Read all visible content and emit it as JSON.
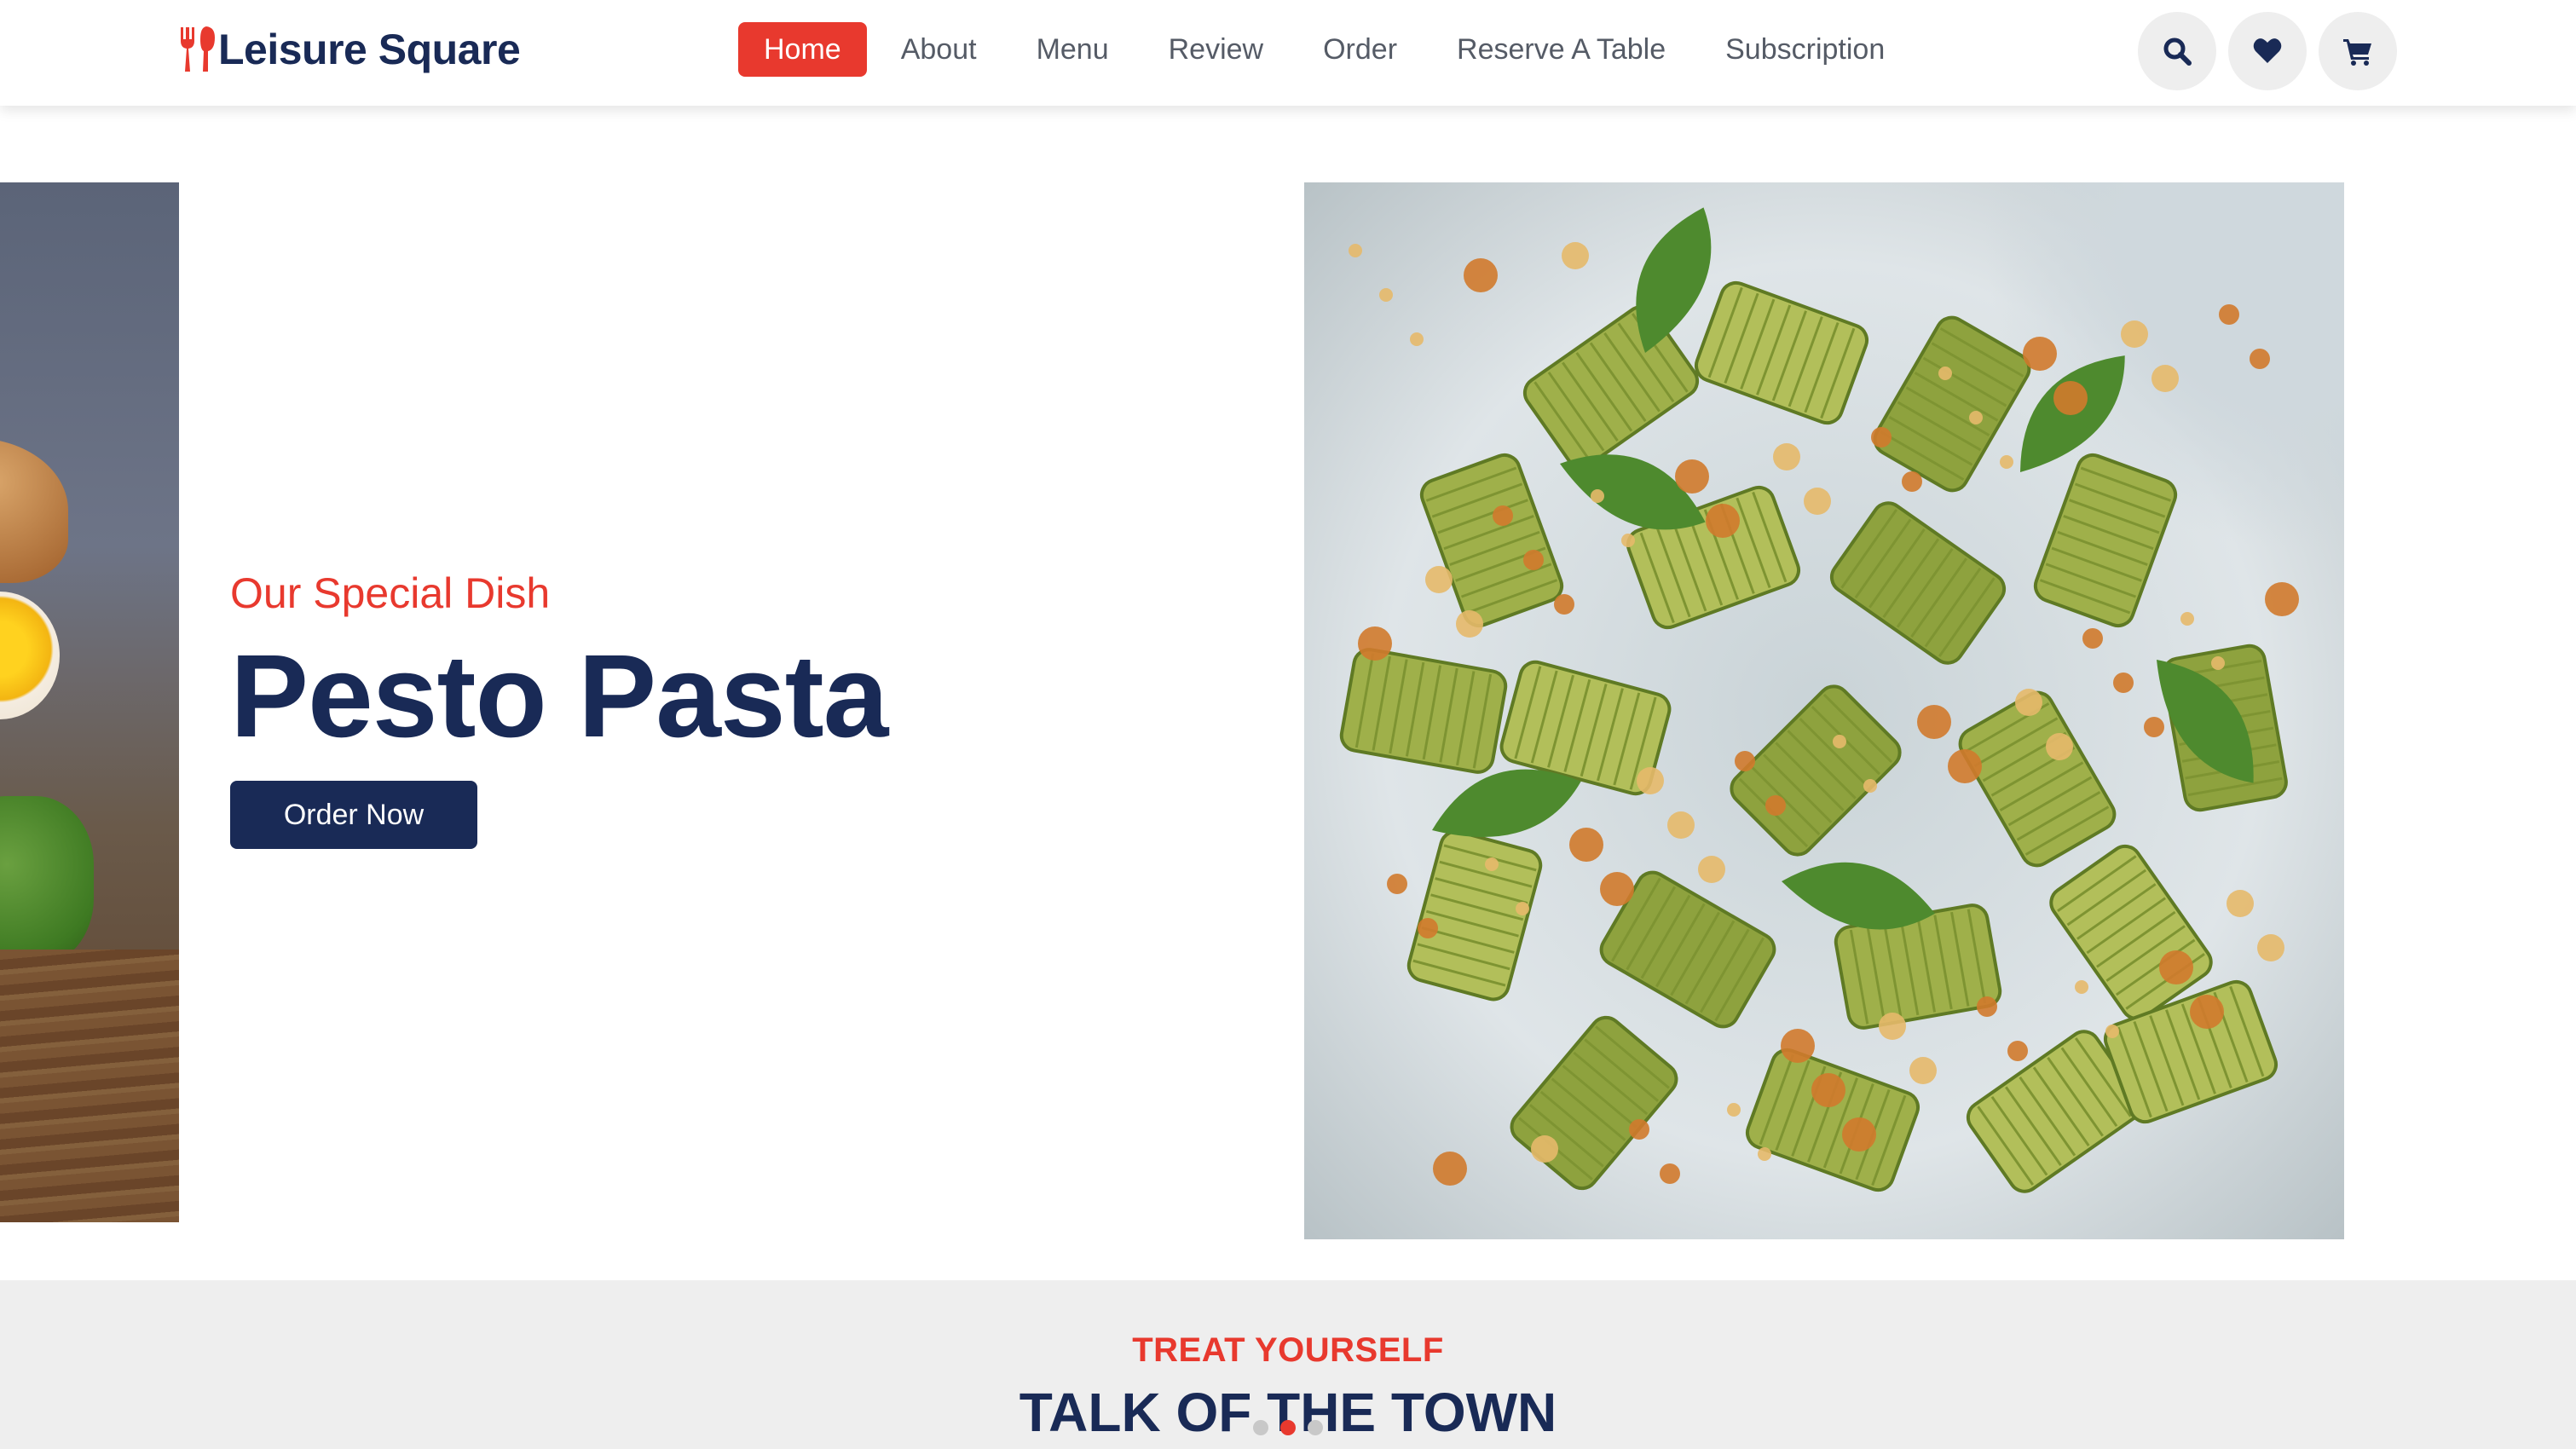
{
  "brand": {
    "name": "Leisure Square",
    "logo_icon": "utensils-icon",
    "accent_color": "#e8392e",
    "primary_color": "#192a56"
  },
  "nav": {
    "items": [
      {
        "label": "Home",
        "active": true
      },
      {
        "label": "About",
        "active": false
      },
      {
        "label": "Menu",
        "active": false
      },
      {
        "label": "Review",
        "active": false
      },
      {
        "label": "Order",
        "active": false
      },
      {
        "label": "Reserve A Table",
        "active": false
      },
      {
        "label": "Subscription",
        "active": false
      }
    ]
  },
  "header_icons": [
    "search-icon",
    "heart-icon",
    "shopping-cart-icon"
  ],
  "hero": {
    "subtitle": "Our Special Dish",
    "title": "Pesto Pasta",
    "cta_label": "Order Now",
    "slide_count": 3,
    "active_slide": 2
  },
  "section": {
    "kicker": "treat yourself",
    "title": "talk of the town"
  }
}
